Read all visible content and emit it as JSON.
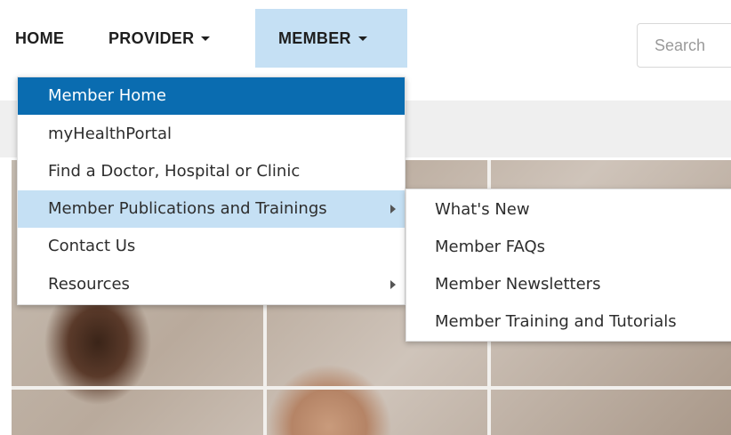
{
  "nav": {
    "home": "HOME",
    "provider": "PROVIDER",
    "member": "MEMBER",
    "search_placeholder": "Search"
  },
  "member_menu": {
    "items": [
      {
        "label": "Member Home",
        "state": "active"
      },
      {
        "label": "myHealthPortal"
      },
      {
        "label": "Find a Doctor, Hospital or Clinic"
      },
      {
        "label": "Member Publications and Trainings",
        "state": "hover",
        "has_submenu": true
      },
      {
        "label": "Contact Us"
      },
      {
        "label": "Resources",
        "has_submenu": true
      }
    ]
  },
  "publications_submenu": {
    "items": [
      {
        "label": "What's New"
      },
      {
        "label": "Member FAQs"
      },
      {
        "label": "Member Newsletters"
      },
      {
        "label": "Member Training and Tutorials"
      }
    ]
  },
  "colors": {
    "active_item_bg": "#0a6cb0",
    "hover_item_bg": "#c5e0f4",
    "member_tab_bg": "#c5e0f4"
  }
}
